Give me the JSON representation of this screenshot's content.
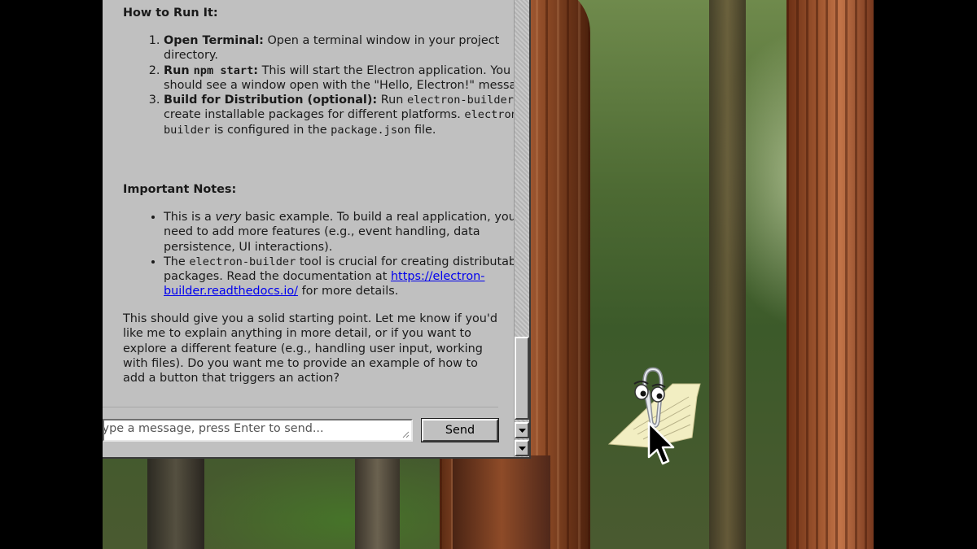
{
  "content": {
    "how_to_run_heading": "How to Run It:",
    "steps": [
      {
        "bold": "Open Terminal:",
        "text": " Open a terminal window in your project directory."
      },
      {
        "bold_prefix": "Run ",
        "bold_code": "npm start",
        "bold_suffix": ":",
        "text": " This will start the Electron application. You should see a window open with the \"Hello, Electron!\" message."
      },
      {
        "bold": "Build for Distribution (optional):",
        "text_1": " Run ",
        "code_1": "electron-builder",
        "text_2": " to create installable packages for different platforms. ",
        "code_2": "electron-builder",
        "text_3": " is configured in the ",
        "code_3": "package.json",
        "text_4": " file."
      }
    ],
    "notes_heading": "Important Notes:",
    "notes": [
      {
        "text_1": "This is a ",
        "em": "very",
        "text_2": " basic example. To build a real application, you'll need to add more features (e.g., event handling, data persistence, UI interactions)."
      },
      {
        "text_1": "The ",
        "code": "electron-builder",
        "text_2": " tool is crucial for creating distributable packages. Read the documentation at ",
        "link": "https://electron-builder.readthedocs.io/",
        "text_3": " for more details."
      }
    ],
    "closing": "This should give you a solid starting point. Let me know if you'd like me to explain anything in more detail, or if you want to explore a different feature (e.g., handling user input, working with files). Do you want me to provide an example of how to add a button that triggers an action?"
  },
  "input": {
    "placeholder": "Type a message, press Enter to send..."
  },
  "send_label": "Send",
  "colors": {
    "window_bg": "#c0c0c0",
    "link": "#0000ee",
    "desktop_letterbox": "#000000"
  },
  "icons": [
    "clippy-assistant-icon",
    "mouse-pointer-icon",
    "scroll-down-arrow-icon",
    "resize-grip-icon"
  ]
}
